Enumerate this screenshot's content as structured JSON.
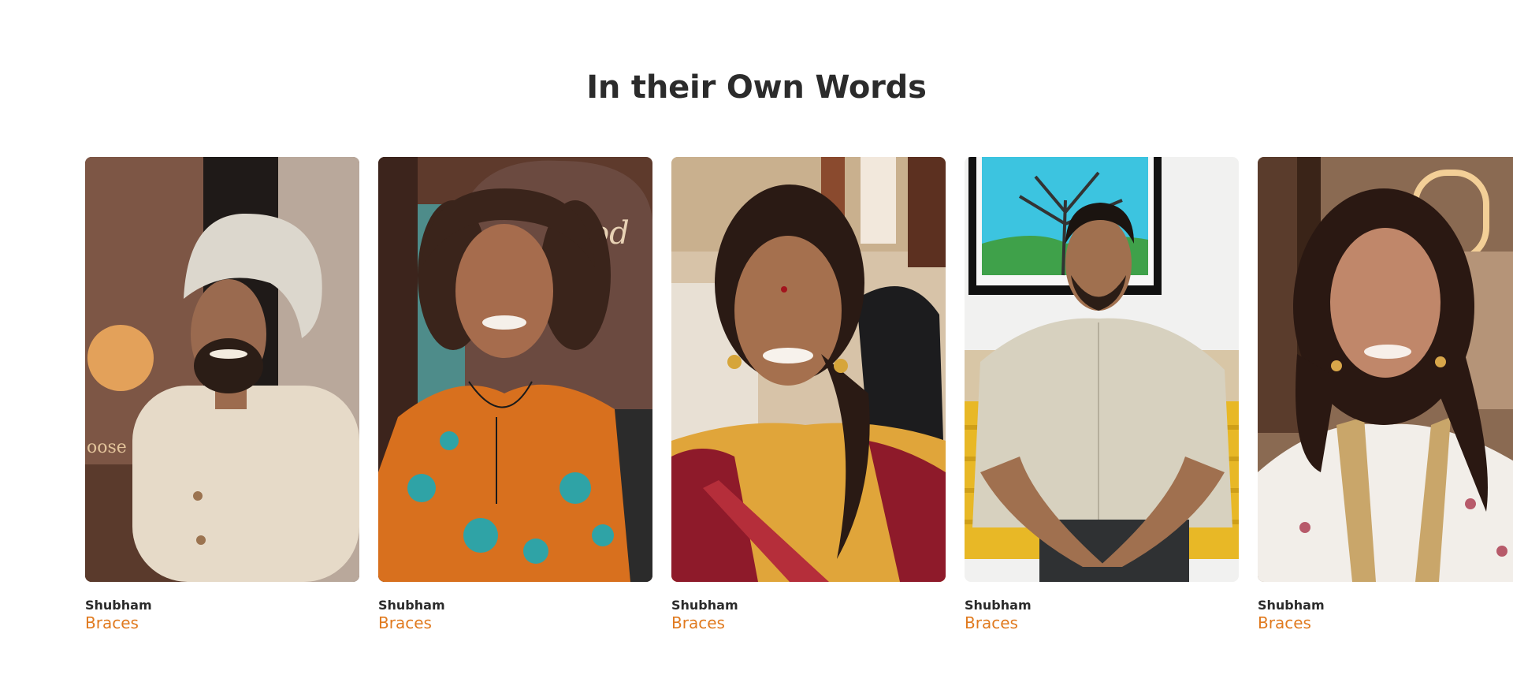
{
  "section": {
    "title": "In their Own Words"
  },
  "colors": {
    "accent": "#e07a1f",
    "heading": "#2b2b2b"
  },
  "testimonials": [
    {
      "name": "Shubham",
      "treatment": "Braces",
      "photo": "portrait-man-turban"
    },
    {
      "name": "Shubham",
      "treatment": "Braces",
      "photo": "portrait-woman-curly-hair"
    },
    {
      "name": "Shubham",
      "treatment": "Braces",
      "photo": "portrait-woman-saree"
    },
    {
      "name": "Shubham",
      "treatment": "Braces",
      "photo": "portrait-man-seated"
    },
    {
      "name": "Shubham",
      "treatment": "Braces",
      "photo": "portrait-woman-long-hair"
    }
  ]
}
